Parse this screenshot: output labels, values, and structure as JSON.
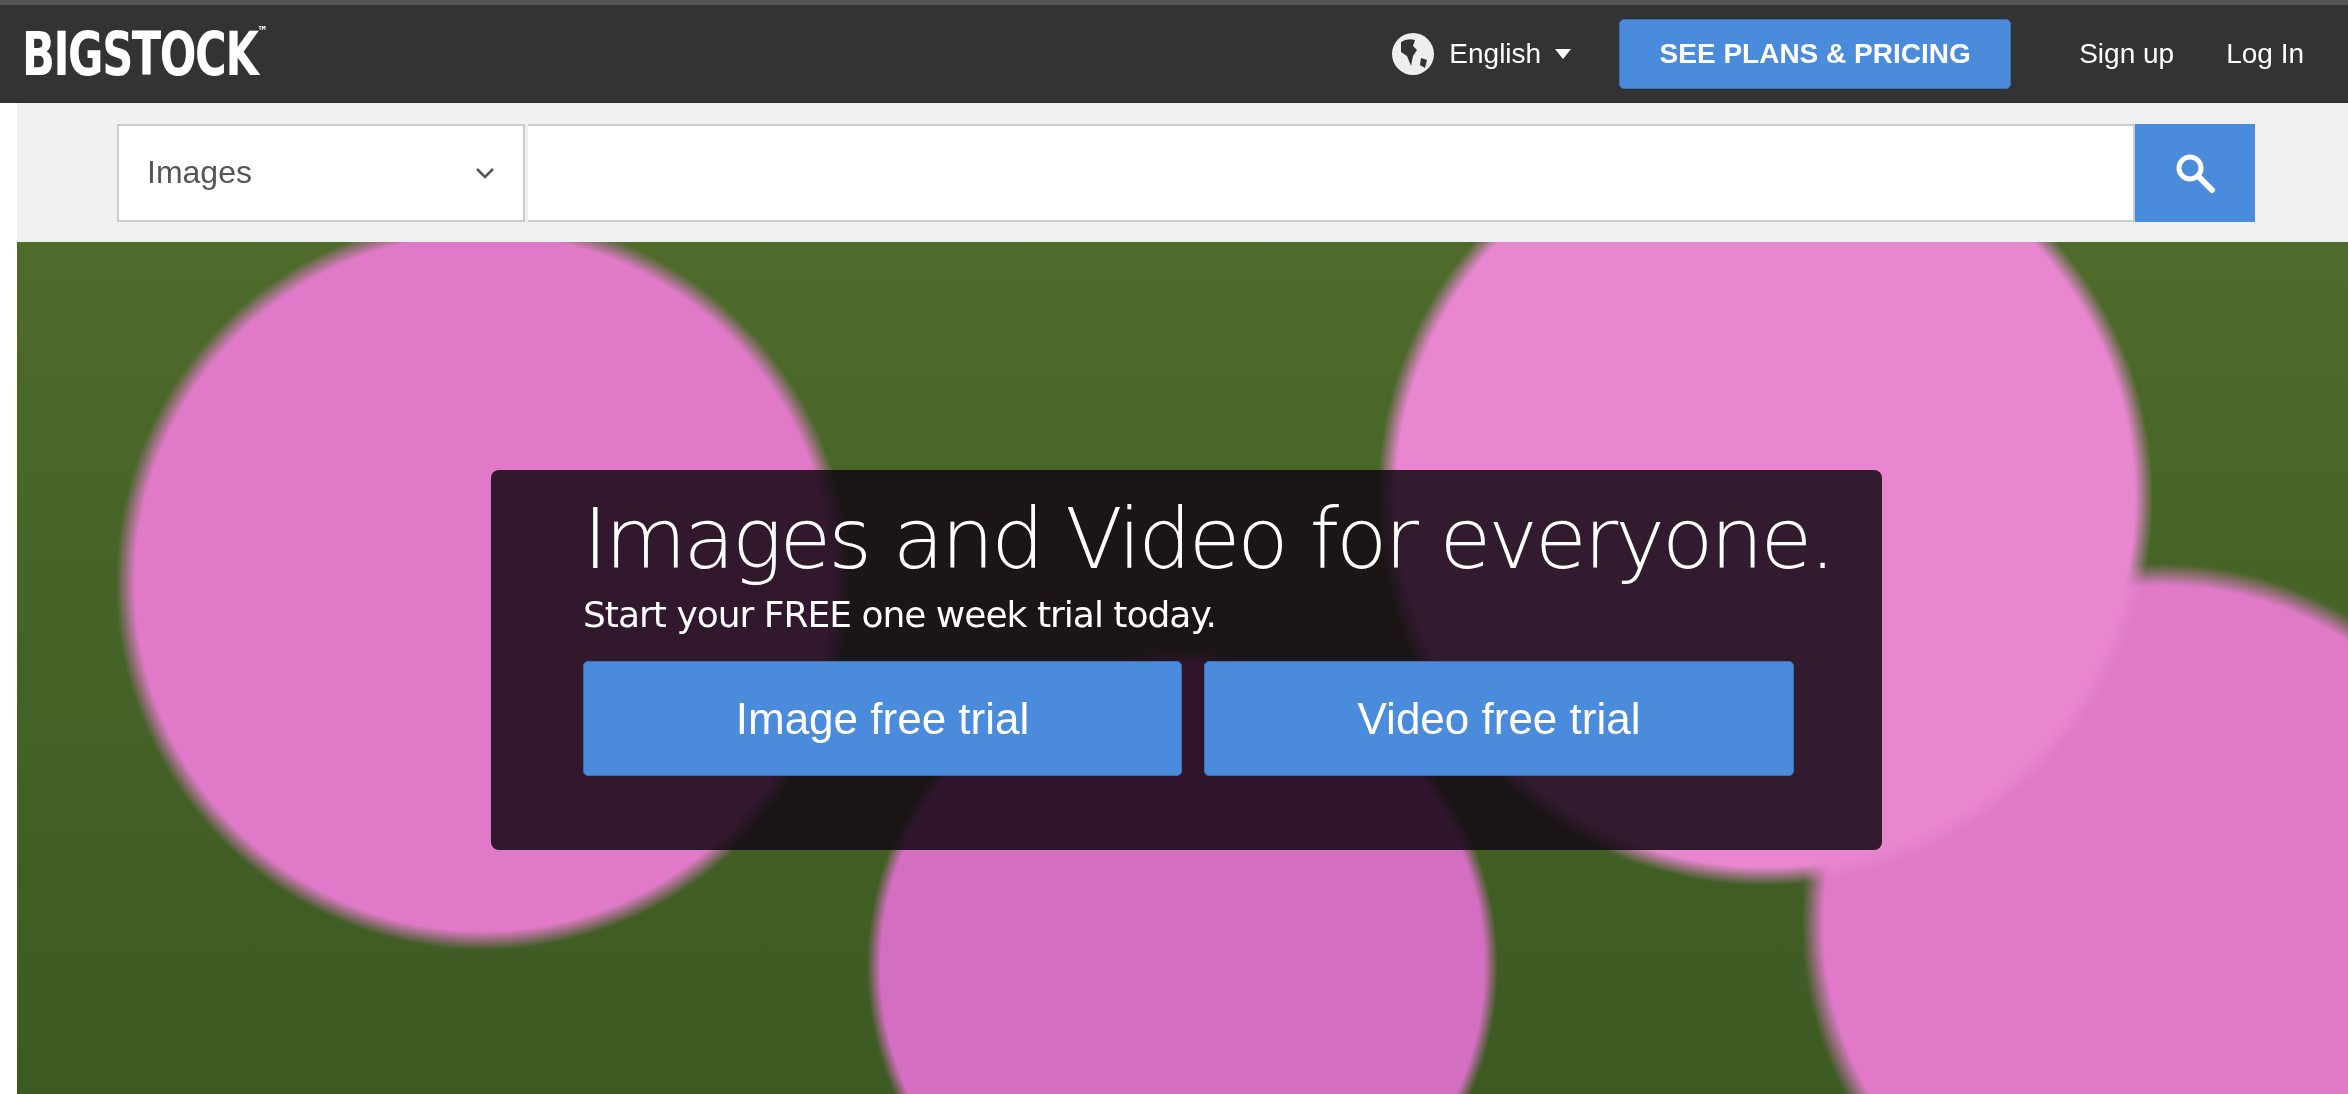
{
  "header": {
    "logo": "BIGSTOCK$^{™}$",
    "language": "English",
    "plans_button": "SEE PLANS & PRICING",
    "links": [
      "Sign up",
      "Log In"
    ]
  },
  "search": {
    "category": "Images"
  },
  "hero": {
    "headline": "Images and Video for everyone.",
    "subtitle": "Start your FREE one week trial today.",
    "buttons": [
      "Image free trial",
      "Video free trial"
    ]
  }
}
